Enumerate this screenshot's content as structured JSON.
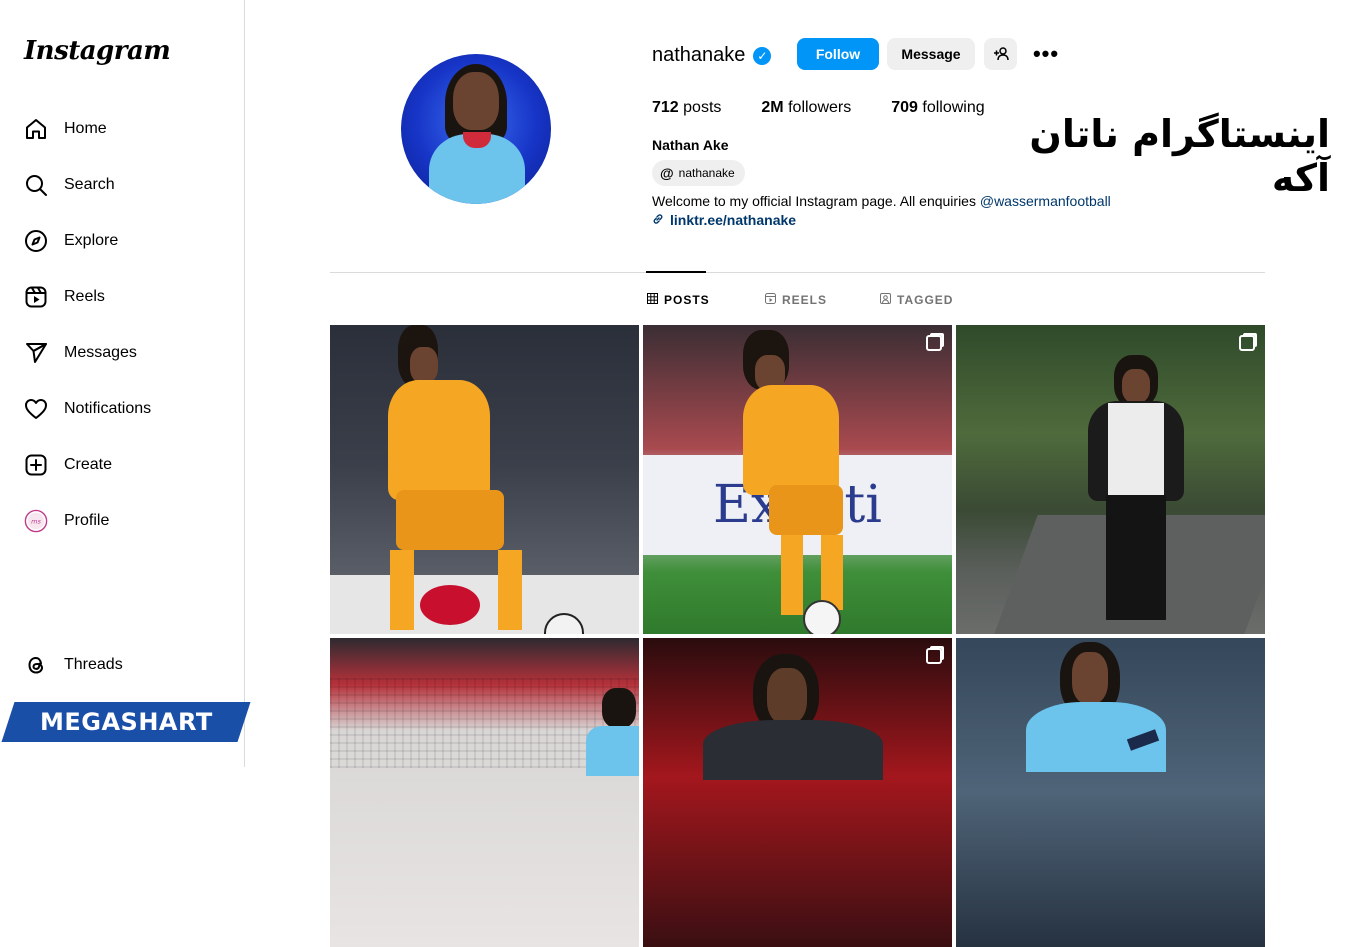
{
  "sidebar": {
    "logo": "Instagram",
    "items": [
      {
        "label": "Home",
        "icon": "home-icon"
      },
      {
        "label": "Search",
        "icon": "search-icon"
      },
      {
        "label": "Explore",
        "icon": "compass-icon"
      },
      {
        "label": "Reels",
        "icon": "reels-icon"
      },
      {
        "label": "Messages",
        "icon": "send-icon"
      },
      {
        "label": "Notifications",
        "icon": "heart-icon"
      },
      {
        "label": "Create",
        "icon": "plus-square-icon"
      },
      {
        "label": "Profile",
        "icon": "avatar-icon"
      }
    ],
    "threads": {
      "label": "Threads",
      "icon": "threads-icon"
    },
    "watermark": "MEGASHART"
  },
  "profile": {
    "username": "nathanake",
    "follow_label": "Follow",
    "message_label": "Message",
    "stats": {
      "posts_count": "712",
      "posts_label": "posts",
      "followers_count": "2M",
      "followers_label": "followers",
      "following_count": "709",
      "following_label": "following"
    },
    "full_name": "Nathan Ake",
    "threads_handle": "nathanake",
    "bio_text": "Welcome to my official Instagram page. All enquiries ",
    "bio_mention": "@wassermanfootball",
    "link": "linktr.ee/nathanake"
  },
  "overlay_caption": "اینستاگرام ناتان آکه",
  "tabs": [
    {
      "label": "POSTS",
      "icon": "grid-icon",
      "active": true
    },
    {
      "label": "REELS",
      "icon": "reels-icon",
      "active": false
    },
    {
      "label": "TAGGED",
      "icon": "tagged-icon",
      "active": false
    }
  ],
  "colors": {
    "accent": "#0095f6",
    "link": "#00376b",
    "netherlands_orange": "#f5a623",
    "city_blue": "#6cc3ec"
  }
}
